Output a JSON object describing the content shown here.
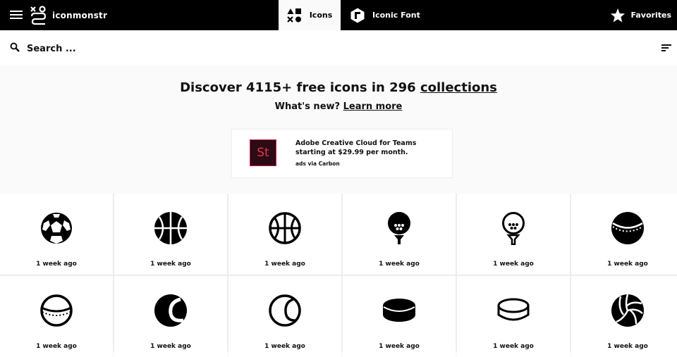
{
  "header": {
    "logo_text": "iconmonstr",
    "tabs": [
      {
        "label": "Icons",
        "active": true
      },
      {
        "label": "Iconic Font",
        "active": false
      }
    ],
    "favorites_label": "Favorites"
  },
  "search": {
    "placeholder": "Search ...",
    "value": ""
  },
  "hero": {
    "headline_prefix": "Discover 4115+ free icons in 296 ",
    "headline_link": "collections",
    "subline_prefix": "What's new? ",
    "subline_link": "Learn more"
  },
  "ad": {
    "logo_text": "St",
    "text": "Adobe Creative Cloud for Teams starting at $29.99 per month.",
    "via": "ads via Carbon"
  },
  "icons": [
    {
      "name": "soccer-ball-icon",
      "time": "1 week ago"
    },
    {
      "name": "basketball-icon",
      "time": "1 week ago"
    },
    {
      "name": "basketball-outline-icon",
      "time": "1 week ago"
    },
    {
      "name": "golf-ball-tee-icon",
      "time": "1 week ago"
    },
    {
      "name": "golf-ball-tee-outline-icon",
      "time": "1 week ago"
    },
    {
      "name": "cricket-ball-icon",
      "time": "1 week ago"
    },
    {
      "name": "cricket-ball-outline-icon",
      "time": "1 week ago"
    },
    {
      "name": "tennis-ball-icon",
      "time": "1 week ago"
    },
    {
      "name": "tennis-ball-outline-icon",
      "time": "1 week ago"
    },
    {
      "name": "hockey-puck-icon",
      "time": "1 week ago"
    },
    {
      "name": "hockey-puck-outline-icon",
      "time": "1 week ago"
    },
    {
      "name": "volleyball-icon",
      "time": "1 week ago"
    }
  ],
  "colors": {
    "header_bg": "#000000",
    "page_bg": "#fafafa",
    "ad_logo_bg": "#2b0b14",
    "ad_logo_accent": "#e8354c"
  }
}
